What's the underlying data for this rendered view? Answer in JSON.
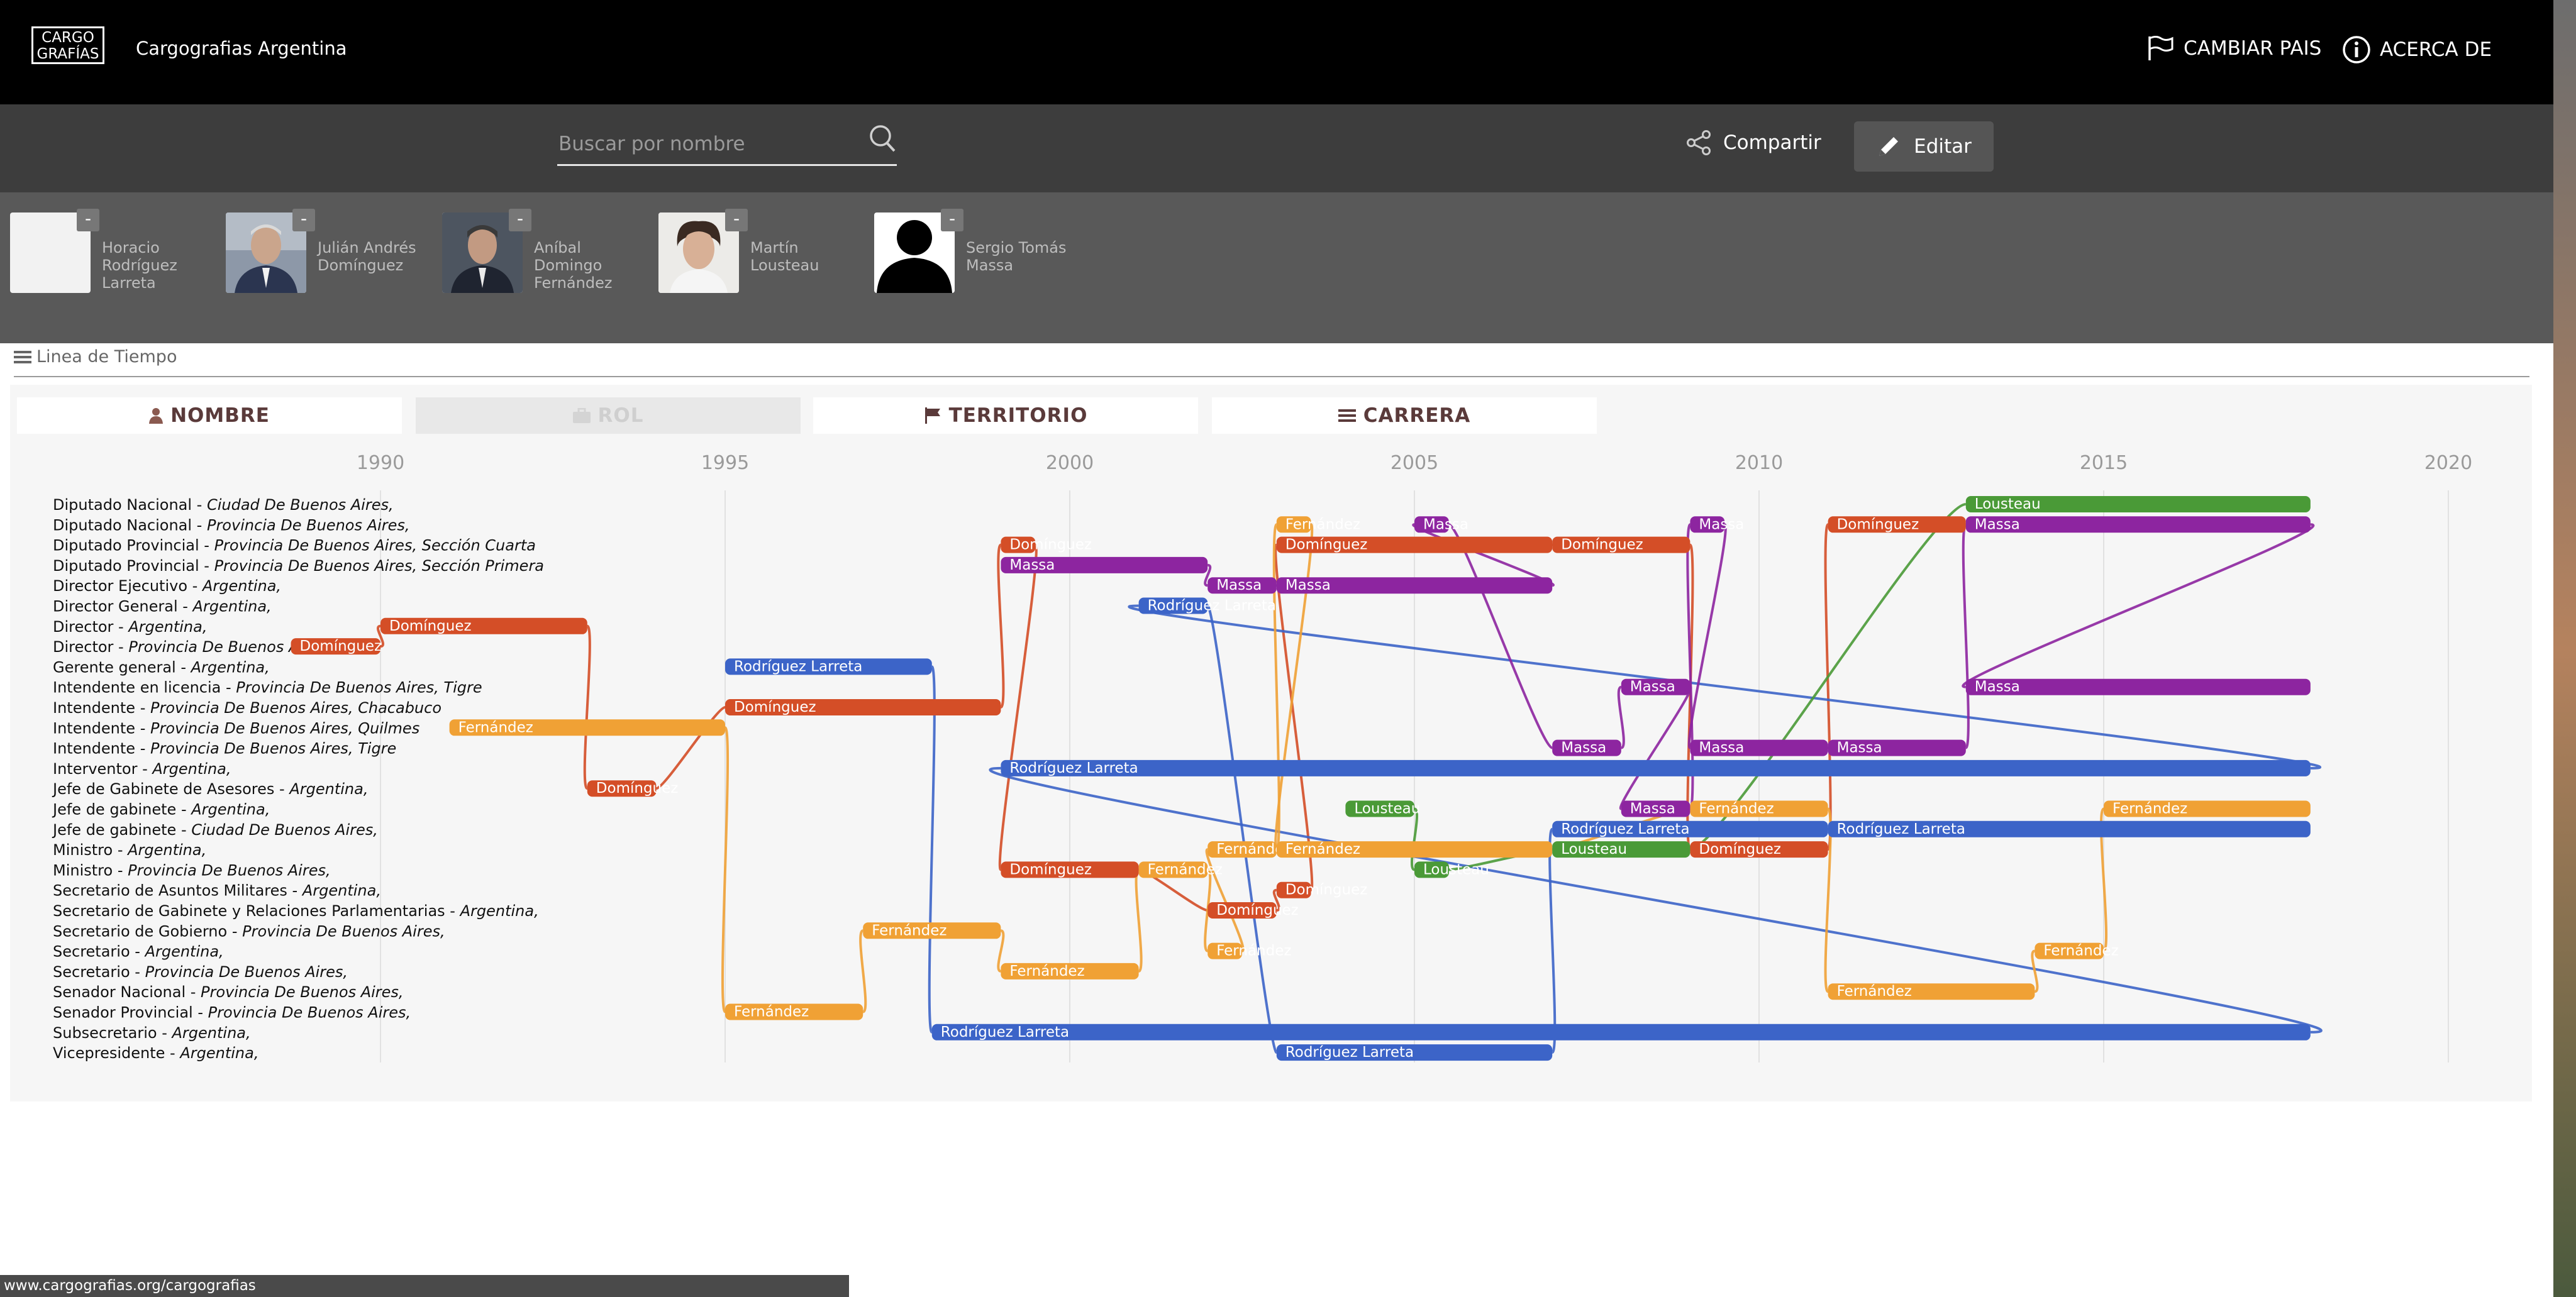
{
  "header": {
    "logo_line1": "CARGO",
    "logo_line2": "GRAFÍAS",
    "title": "Cargografias Argentina",
    "change_country": "CAMBIAR PAIS",
    "about": "ACERCA DE"
  },
  "toolbar": {
    "search_placeholder": "Buscar por nombre",
    "share_label": "Compartir",
    "edit_label": "Editar"
  },
  "people": [
    {
      "name": "Horacio Rodríguez Larreta",
      "photo": "blank",
      "remove_label": "-"
    },
    {
      "name": "Julián Andrés Domínguez",
      "photo": "portrait",
      "remove_label": "-"
    },
    {
      "name": "Aníbal Domingo Fernández",
      "photo": "portrait",
      "remove_label": "-"
    },
    {
      "name": "Martín Lousteau",
      "photo": "portrait",
      "remove_label": "-"
    },
    {
      "name": "Sergio Tomás Massa",
      "photo": "silhouette",
      "remove_label": "-"
    }
  ],
  "timeline": {
    "section_title": "Linea de Tiempo",
    "tabs": [
      {
        "label": "NOMBRE",
        "icon": "user-icon",
        "enabled": true
      },
      {
        "label": "ROL",
        "icon": "briefcase-icon",
        "enabled": false
      },
      {
        "label": "TERRITORIO",
        "icon": "flag-icon",
        "enabled": true
      },
      {
        "label": "CARRERA",
        "icon": "list-icon",
        "enabled": true
      }
    ]
  },
  "chart_data": {
    "type": "timeline",
    "x_ticks": [
      1990,
      1995,
      2000,
      2005,
      2010,
      2015,
      2020
    ],
    "xlim": [
      1990,
      2020
    ],
    "grid": true,
    "colors": {
      "Rodríguez Larreta": "#3c64c8",
      "Domínguez": "#d44e27",
      "Fernández": "#f0a135",
      "Lousteau": "#4a9a37",
      "Massa": "#8d25a0"
    },
    "rows": [
      {
        "role": "Diputado Nacional",
        "territory": "Ciudad De Buenos Aires,"
      },
      {
        "role": "Diputado Nacional",
        "territory": "Provincia De Buenos Aires,"
      },
      {
        "role": "Diputado Provincial",
        "territory": "Provincia De Buenos Aires, Sección Cuarta"
      },
      {
        "role": "Diputado Provincial",
        "territory": "Provincia De Buenos Aires, Sección Primera"
      },
      {
        "role": "Director Ejecutivo",
        "territory": "Argentina,"
      },
      {
        "role": "Director General",
        "territory": "Argentina,"
      },
      {
        "role": "Director",
        "territory": "Argentina,"
      },
      {
        "role": "Director",
        "territory": "Provincia De Buenos Aires,"
      },
      {
        "role": "Gerente general",
        "territory": "Argentina,"
      },
      {
        "role": "Intendente en licencia",
        "territory": "Provincia De Buenos Aires, Tigre"
      },
      {
        "role": "Intendente",
        "territory": "Provincia De Buenos Aires, Chacabuco"
      },
      {
        "role": "Intendente",
        "territory": "Provincia De Buenos Aires, Quilmes"
      },
      {
        "role": "Intendente",
        "territory": "Provincia De Buenos Aires, Tigre"
      },
      {
        "role": "Interventor",
        "territory": "Argentina,"
      },
      {
        "role": "Jefe de Gabinete de Asesores",
        "territory": "Argentina,"
      },
      {
        "role": "Jefe de gabinete",
        "territory": "Argentina,"
      },
      {
        "role": "Jefe de gabinete",
        "territory": "Ciudad De Buenos Aires,"
      },
      {
        "role": "Ministro",
        "territory": "Argentina,"
      },
      {
        "role": "Ministro",
        "territory": "Provincia De Buenos Aires,"
      },
      {
        "role": "Secretario de Asuntos Militares",
        "territory": "Argentina,"
      },
      {
        "role": "Secretario de Gabinete y Relaciones Parlamentarias",
        "territory": "Argentina,"
      },
      {
        "role": "Secretario de Gobierno",
        "territory": "Provincia De Buenos Aires,"
      },
      {
        "role": "Secretario",
        "territory": "Argentina,"
      },
      {
        "role": "Secretario",
        "territory": "Provincia De Buenos Aires,"
      },
      {
        "role": "Senador Nacional",
        "territory": "Provincia De Buenos Aires,"
      },
      {
        "role": "Senador Provincial",
        "territory": "Provincia De Buenos Aires,"
      },
      {
        "role": "Subsecretario",
        "territory": "Argentina,"
      },
      {
        "role": "Vicepresidente",
        "territory": "Argentina,"
      }
    ],
    "bars": [
      {
        "person": "Domínguez",
        "row": 7,
        "start": 1988.7,
        "end": 1990.0,
        "label": "Domínguez"
      },
      {
        "person": "Domínguez",
        "row": 6,
        "start": 1990.0,
        "end": 1993.0,
        "label": "Domínguez"
      },
      {
        "person": "Domínguez",
        "row": 14,
        "start": 1993.0,
        "end": 1994.0,
        "label": "Domínguez"
      },
      {
        "person": "Domínguez",
        "row": 10,
        "start": 1995.0,
        "end": 1999.0,
        "label": "Domínguez"
      },
      {
        "person": "Domínguez",
        "row": 18,
        "start": 1999.0,
        "end": 2001.0,
        "label": "Domínguez"
      },
      {
        "person": "Domínguez",
        "row": 2,
        "start": 1999.0,
        "end": 1999.5,
        "label": "Domínguez"
      },
      {
        "person": "Domínguez",
        "row": 20,
        "start": 2002.0,
        "end": 2003.0,
        "label": "Domínguez"
      },
      {
        "person": "Domínguez",
        "row": 19,
        "start": 2003.0,
        "end": 2003.5,
        "label": "Domínguez"
      },
      {
        "person": "Domínguez",
        "row": 2,
        "start": 2003.0,
        "end": 2007.0,
        "label": "Domínguez"
      },
      {
        "person": "Domínguez",
        "row": 2,
        "start": 2007.0,
        "end": 2009.0,
        "label": "Domínguez"
      },
      {
        "person": "Domínguez",
        "row": 17,
        "start": 2009.0,
        "end": 2011.0,
        "label": "Domínguez"
      },
      {
        "person": "Domínguez",
        "row": 1,
        "start": 2011.0,
        "end": 2013.0,
        "label": "Domínguez"
      },
      {
        "person": "Rodríguez Larreta",
        "row": 8,
        "start": 1995.0,
        "end": 1998.0,
        "label": "Rodríguez Larreta"
      },
      {
        "person": "Rodríguez Larreta",
        "row": 26,
        "start": 1998.0,
        "end": 2018.0,
        "label": "Rodríguez Larreta"
      },
      {
        "person": "Rodríguez Larreta",
        "row": 13,
        "start": 1999.0,
        "end": 2018.0,
        "label": "Rodríguez Larreta"
      },
      {
        "person": "Rodríguez Larreta",
        "row": 5,
        "start": 2001.0,
        "end": 2002.0,
        "label": "Rodríguez Larreta"
      },
      {
        "person": "Rodríguez Larreta",
        "row": 27,
        "start": 2003.0,
        "end": 2007.0,
        "label": "Rodríguez Larreta"
      },
      {
        "person": "Rodríguez Larreta",
        "row": 16,
        "start": 2007.0,
        "end": 2011.0,
        "label": "Rodríguez Larreta"
      },
      {
        "person": "Rodríguez Larreta",
        "row": 16,
        "start": 2011.0,
        "end": 2018.0,
        "label": "Rodríguez Larreta"
      },
      {
        "person": "Fernández",
        "row": 11,
        "start": 1991.0,
        "end": 1995.0,
        "label": "Fernández"
      },
      {
        "person": "Fernández",
        "row": 25,
        "start": 1995.0,
        "end": 1997.0,
        "label": "Fernández"
      },
      {
        "person": "Fernández",
        "row": 21,
        "start": 1997.0,
        "end": 1999.0,
        "label": "Fernández"
      },
      {
        "person": "Fernández",
        "row": 23,
        "start": 1999.0,
        "end": 2001.0,
        "label": "Fernández"
      },
      {
        "person": "Fernández",
        "row": 18,
        "start": 2001.0,
        "end": 2002.0,
        "label": "Fernández"
      },
      {
        "person": "Fernández",
        "row": 17,
        "start": 2002.0,
        "end": 2003.0,
        "label": "Fernández"
      },
      {
        "person": "Fernández",
        "row": 22,
        "start": 2002.0,
        "end": 2002.5,
        "label": "Fernández"
      },
      {
        "person": "Fernández",
        "row": 1,
        "start": 2003.0,
        "end": 2003.5,
        "label": "Fernández"
      },
      {
        "person": "Fernández",
        "row": 17,
        "start": 2003.0,
        "end": 2007.0,
        "label": "Fernández"
      },
      {
        "person": "Fernández",
        "row": 15,
        "start": 2009.0,
        "end": 2011.0,
        "label": "Fernández"
      },
      {
        "person": "Fernández",
        "row": 24,
        "start": 2011.0,
        "end": 2014.0,
        "label": "Fernández"
      },
      {
        "person": "Fernández",
        "row": 22,
        "start": 2014.0,
        "end": 2015.0,
        "label": "Fernández"
      },
      {
        "person": "Fernández",
        "row": 15,
        "start": 2015.0,
        "end": 2018.0,
        "label": "Fernández"
      },
      {
        "person": "Lousteau",
        "row": 15,
        "start": 2004.0,
        "end": 2005.0,
        "label": "Lousteau"
      },
      {
        "person": "Lousteau",
        "row": 18,
        "start": 2005.0,
        "end": 2005.5,
        "label": "Lousteau"
      },
      {
        "person": "Lousteau",
        "row": 17,
        "start": 2007.0,
        "end": 2009.0,
        "label": "Lousteau"
      },
      {
        "person": "Lousteau",
        "row": 0,
        "start": 2013.0,
        "end": 2018.0,
        "label": "Lousteau"
      },
      {
        "person": "Massa",
        "row": 3,
        "start": 1999.0,
        "end": 2002.0,
        "label": "Massa"
      },
      {
        "person": "Massa",
        "row": 4,
        "start": 2002.0,
        "end": 2003.0,
        "label": "Massa"
      },
      {
        "person": "Massa",
        "row": 4,
        "start": 2003.0,
        "end": 2007.0,
        "label": "Massa"
      },
      {
        "person": "Massa",
        "row": 1,
        "start": 2005.0,
        "end": 2005.5,
        "label": "Massa"
      },
      {
        "person": "Massa",
        "row": 12,
        "start": 2007.0,
        "end": 2008.0,
        "label": "Massa"
      },
      {
        "person": "Massa",
        "row": 9,
        "start": 2008.0,
        "end": 2009.0,
        "label": "Massa"
      },
      {
        "person": "Massa",
        "row": 15,
        "start": 2008.0,
        "end": 2009.0,
        "label": "Massa"
      },
      {
        "person": "Massa",
        "row": 1,
        "start": 2009.0,
        "end": 2009.5,
        "label": "Massa"
      },
      {
        "person": "Massa",
        "row": 12,
        "start": 2009.0,
        "end": 2011.0,
        "label": "Massa"
      },
      {
        "person": "Massa",
        "row": 12,
        "start": 2011.0,
        "end": 2013.0,
        "label": "Massa"
      },
      {
        "person": "Massa",
        "row": 1,
        "start": 2013.0,
        "end": 2018.0,
        "label": "Massa"
      },
      {
        "person": "Massa",
        "row": 9,
        "start": 2013.0,
        "end": 2018.0,
        "label": "Massa"
      }
    ]
  },
  "footer": {
    "status_url": "www.cargografias.org/cargografias"
  }
}
